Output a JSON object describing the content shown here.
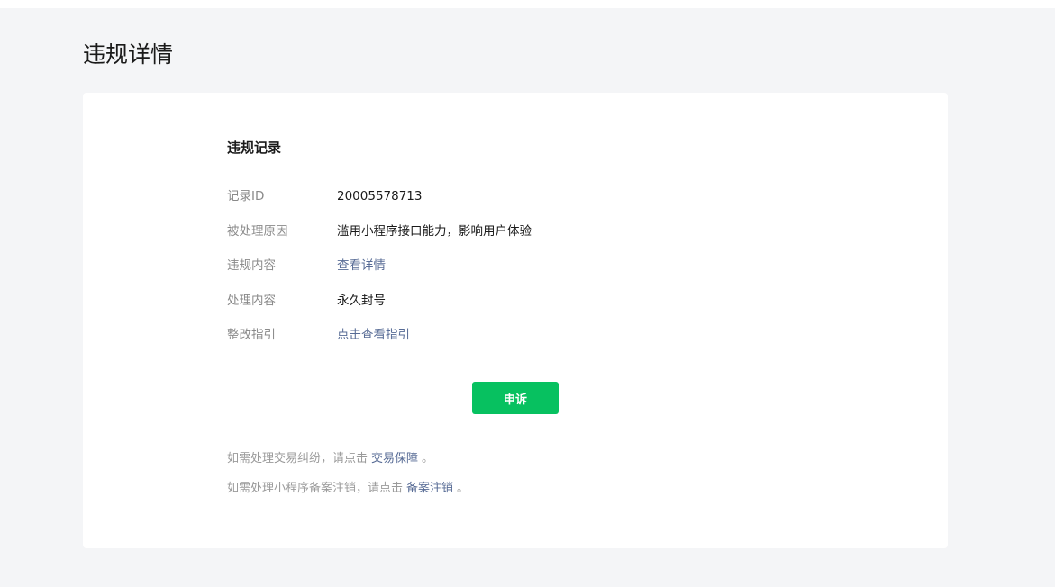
{
  "page": {
    "title": "违规详情"
  },
  "record": {
    "section_title": "违规记录",
    "rows": [
      {
        "label": "记录ID",
        "value": "20005578713"
      },
      {
        "label": "被处理原因",
        "value": "滥用小程序接口能力，影响用户体验"
      },
      {
        "label": "违规内容",
        "value": "查看详情"
      },
      {
        "label": "处理内容",
        "value": "永久封号"
      },
      {
        "label": "整改指引",
        "value": "点击查看指引"
      }
    ]
  },
  "actions": {
    "appeal_label": "申诉"
  },
  "notes": {
    "trade": {
      "prefix": "如需处理交易纠纷，请点击",
      "link": "交易保障",
      "suffix": "。"
    },
    "filing": {
      "prefix": "如需处理小程序备案注销，请点击",
      "link": "备案注销",
      "suffix": "。"
    }
  },
  "colors": {
    "primary_button": "#07c160",
    "link": "#576b95",
    "background": "#f4f5f7"
  }
}
